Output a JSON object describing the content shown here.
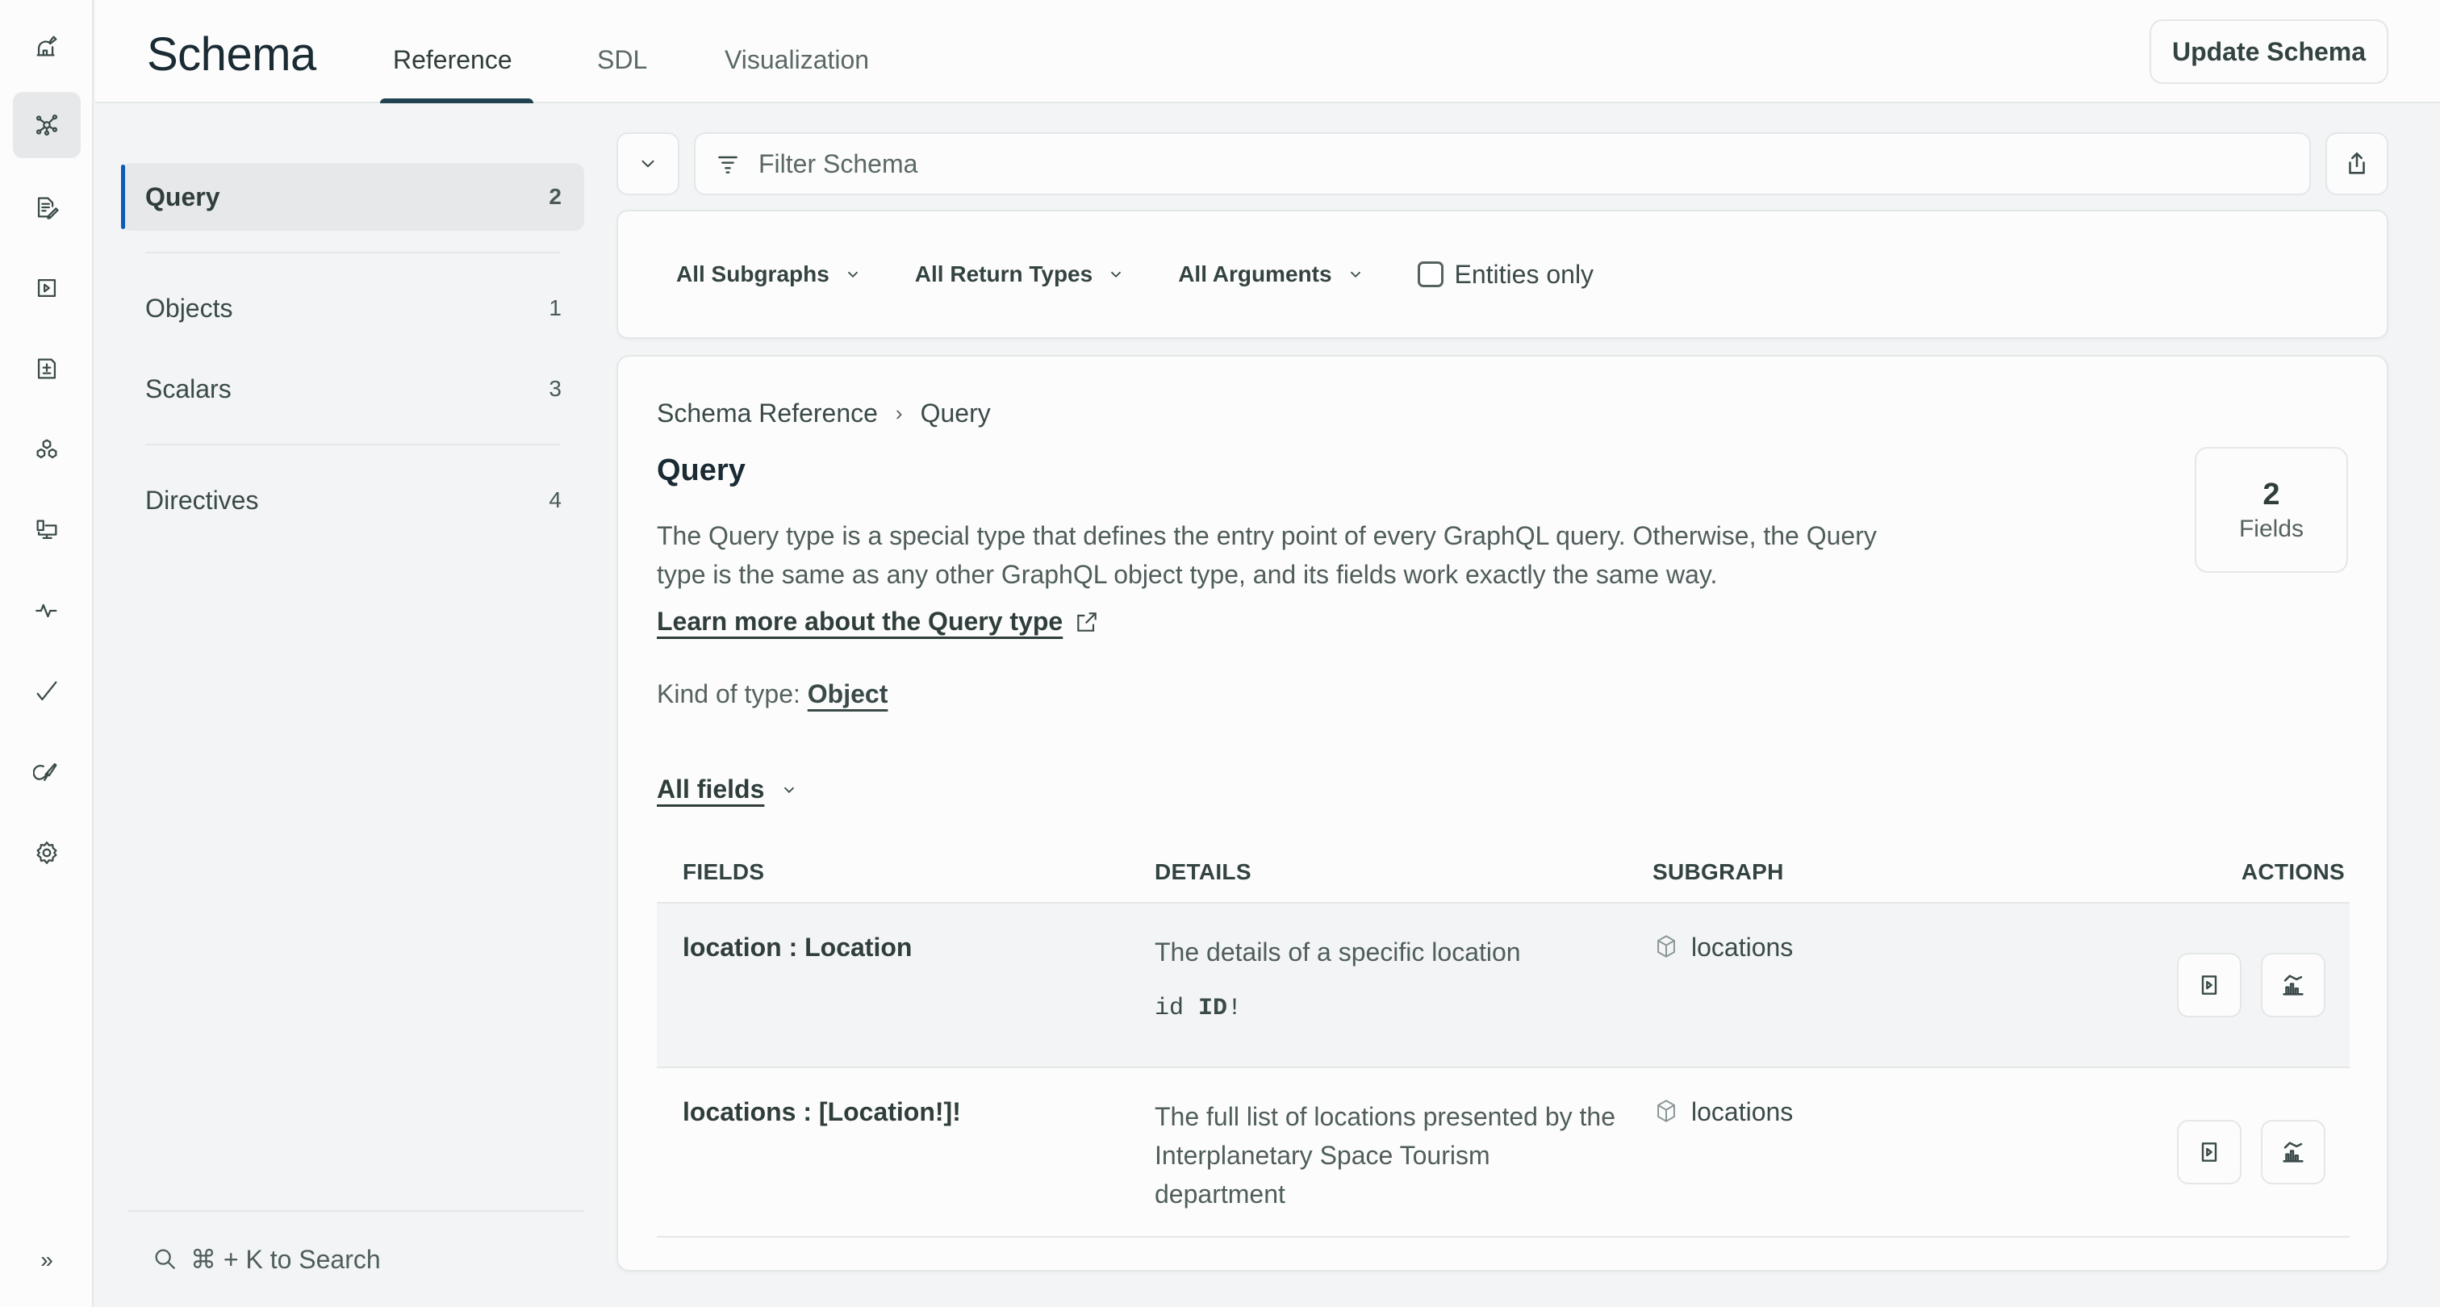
{
  "rail": {
    "items": [
      {
        "name": "observatory-icon",
        "active": false
      },
      {
        "name": "schema-graph-icon",
        "active": true
      },
      {
        "name": "explorer-edit-icon",
        "active": false
      },
      {
        "name": "play-icon",
        "active": false
      },
      {
        "name": "changelog-icon",
        "active": false
      },
      {
        "name": "subgraphs-icon",
        "active": false
      },
      {
        "name": "clients-icon",
        "active": false
      },
      {
        "name": "insights-icon",
        "active": false
      },
      {
        "name": "checks-icon",
        "active": false
      },
      {
        "name": "launches-icon",
        "active": false
      },
      {
        "name": "settings-icon",
        "active": false
      }
    ],
    "expand_label": "»"
  },
  "header": {
    "title": "Schema",
    "tabs": [
      {
        "label": "Reference",
        "active": true
      },
      {
        "label": "SDL",
        "active": false
      },
      {
        "label": "Visualization",
        "active": false
      }
    ],
    "update_button": "Update Schema"
  },
  "type_nav": {
    "items": [
      {
        "label": "Query",
        "count": "2",
        "active": true
      },
      {
        "label": "Objects",
        "count": "1",
        "active": false
      },
      {
        "label": "Scalars",
        "count": "3",
        "active": false
      },
      {
        "label": "Directives",
        "count": "4",
        "active": false
      }
    ],
    "search_hint": "⌘ + K to Search"
  },
  "filter": {
    "placeholder": "Filter Schema",
    "value": "",
    "dropdowns": [
      "All Subgraphs",
      "All Return Types",
      "All Arguments"
    ],
    "entities_only_label": "Entities only",
    "entities_only_checked": false
  },
  "detail": {
    "breadcrumb": [
      "Schema Reference",
      "Query"
    ],
    "title": "Query",
    "description": "The Query type is a special type that defines the entry point of every GraphQL query. Otherwise, the Query type is the same as any other GraphQL object type, and its fields work exactly the same way.",
    "learn_more": "Learn more about the Query type",
    "kind_prefix": "Kind of type:",
    "kind_value": "Object",
    "fields_count": "2",
    "fields_label": "Fields",
    "all_fields_label": "All fields"
  },
  "table": {
    "headers": [
      "FIELDS",
      "DETAILS",
      "SUBGRAPH",
      "ACTIONS"
    ],
    "rows": [
      {
        "field": "location : Location",
        "details": "The details of a specific location",
        "arg_name": "id",
        "arg_type": "ID",
        "arg_suffix": "!",
        "subgraph": "locations"
      },
      {
        "field": "locations : [Location!]!",
        "details": "The full list of locations presented by the Interplanetary Space Tourism department",
        "subgraph": "locations"
      }
    ]
  },
  "colors": {
    "accent_blue": "#0a5cb8",
    "tab_underline": "#1f4350",
    "background": "#f2f4f5",
    "surface": "#fcfcfc"
  }
}
